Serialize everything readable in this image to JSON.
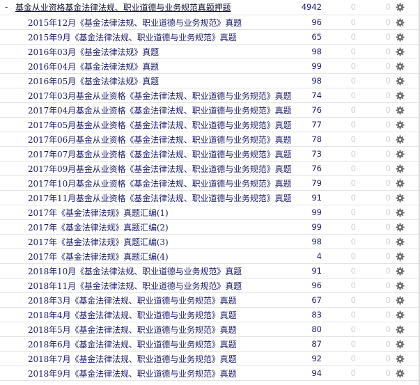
{
  "parent": {
    "collapse": "-",
    "name": "基金从业资格基金法律法规、职业道德与业务规范真题押题",
    "new": "4942",
    "learn": "0",
    "due": "0"
  },
  "decks": [
    {
      "name": "2015年12月《基金法律法规、职业道德与业务规范》真题",
      "new": "96",
      "learn": "0",
      "due": "0"
    },
    {
      "name": "2015年9月《基金法律法规、职业道德与业务规范》真题",
      "new": "65",
      "learn": "0",
      "due": "0"
    },
    {
      "name": "2016年03月《基金法律法规》真题",
      "new": "98",
      "learn": "0",
      "due": "0"
    },
    {
      "name": "2016年04月《基金法律法规》真题",
      "new": "99",
      "learn": "0",
      "due": "0"
    },
    {
      "name": "2016年05月《基金法律法规》真题",
      "new": "98",
      "learn": "0",
      "due": "0"
    },
    {
      "name": "2017年03月基金从业资格《基金法律法规、职业道德与业务规范》真题",
      "new": "74",
      "learn": "0",
      "due": "0"
    },
    {
      "name": "2017年04月基金从业资格《基金法律法规、职业道德与业务规范》真题",
      "new": "76",
      "learn": "0",
      "due": "0"
    },
    {
      "name": "2017年05月基金从业资格《基金法律法规、职业道德与业务规范》真题",
      "new": "77",
      "learn": "0",
      "due": "0"
    },
    {
      "name": "2017年06月基金从业资格《基金法律法规、职业道德与业务规范》真题",
      "new": "78",
      "learn": "0",
      "due": "0"
    },
    {
      "name": "2017年07月基金从业资格《基金法律法规、职业道德与业务规范》真题",
      "new": "73",
      "learn": "0",
      "due": "0"
    },
    {
      "name": "2017年09月基金从业资格《基金法律法规、职业道德与业务规范》真题",
      "new": "76",
      "learn": "0",
      "due": "0"
    },
    {
      "name": "2017年10月基金从业资格《基金法律法规、职业道德与业务规范》真题",
      "new": "79",
      "learn": "0",
      "due": "0"
    },
    {
      "name": "2017年11月基金从业资格《基金法律法规、职业道德与业务规范》真题",
      "new": "91",
      "learn": "0",
      "due": "0"
    },
    {
      "name": "2017年《基金法律法规》真题汇编(1)",
      "new": "99",
      "learn": "0",
      "due": "0"
    },
    {
      "name": "2017年《基金法律法规》真题汇编(2)",
      "new": "99",
      "learn": "0",
      "due": "0"
    },
    {
      "name": "2017年《基金法律法规》真题汇编(3)",
      "new": "98",
      "learn": "0",
      "due": "0"
    },
    {
      "name": "2017年《基金法律法规》真题汇编(4)",
      "new": "4",
      "learn": "0",
      "due": "0"
    },
    {
      "name": "2018年10月《基金法律法规、职业道德与业务规范》真题",
      "new": "91",
      "learn": "0",
      "due": "0"
    },
    {
      "name": "2018年11月《基金法律法规、职业道德与业务规范》真题",
      "new": "96",
      "learn": "0",
      "due": "0"
    },
    {
      "name": "2018年3月《基金法律法规、职业道德与业务规范》真题",
      "new": "67",
      "learn": "0",
      "due": "0"
    },
    {
      "name": "2018年4月《基金法律法规、职业道德与业务规范》真题",
      "new": "83",
      "learn": "0",
      "due": "0"
    },
    {
      "name": "2018年5月《基金法律法规、职业道德与业务规范》真题",
      "new": "80",
      "learn": "0",
      "due": "0"
    },
    {
      "name": "2018年6月《基金法律法规、职业道德与业务规范》真题",
      "new": "87",
      "learn": "0",
      "due": "0"
    },
    {
      "name": "2018年7月《基金法律法规、职业道德与业务规范》真题",
      "new": "92",
      "learn": "0",
      "due": "0"
    },
    {
      "name": "2018年9月《基金法律法规、职业道德与业务规范》真题",
      "new": "94",
      "learn": "0",
      "due": "0"
    }
  ],
  "icons": {
    "options": "gear-icon"
  },
  "colors": {
    "deck_name": "#1c1c6e",
    "new_count": "#1a1a7a",
    "zero_count": "#cfcfcf",
    "gear": "#6b6b6b",
    "row_border": "#e4e4e4"
  }
}
